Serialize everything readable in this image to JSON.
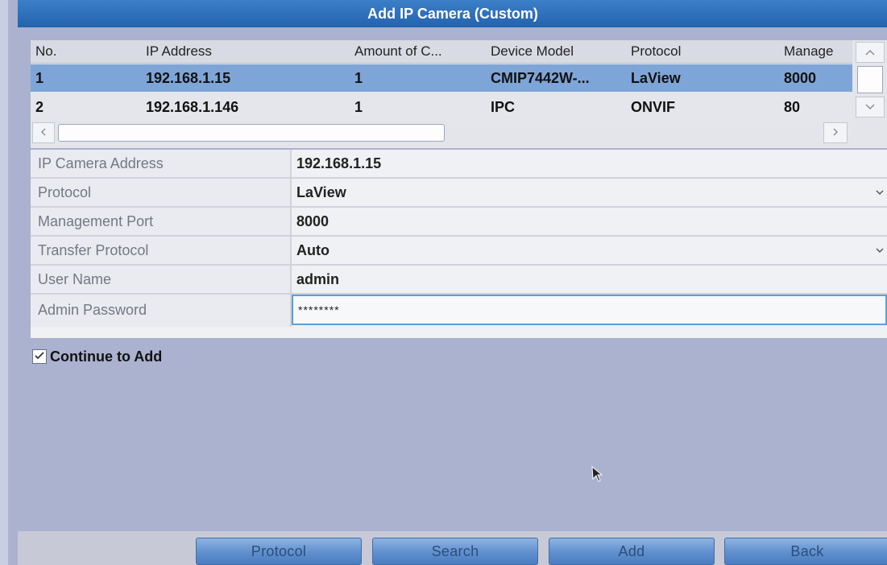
{
  "title": "Add IP Camera (Custom)",
  "table": {
    "columns": [
      "No.",
      "IP Address",
      "Amount of C...",
      "Device Model",
      "Protocol",
      "Manage"
    ],
    "rows": [
      {
        "no": "1",
        "ip": "192.168.1.15",
        "amount": "1",
        "model": "CMIP7442W-...",
        "protocol": "LaView",
        "port": "8000",
        "selected": true
      },
      {
        "no": "2",
        "ip": "192.168.1.146",
        "amount": "1",
        "model": "IPC",
        "protocol": "ONVIF",
        "port": "80",
        "selected": false
      }
    ],
    "scroll_up_icon": "^",
    "scroll_down_icon": "v",
    "scroll_left_icon": "<",
    "scroll_right_icon": ">"
  },
  "form": {
    "ip_camera_address": {
      "label": "IP Camera Address",
      "value": "192.168.1.15"
    },
    "protocol": {
      "label": "Protocol",
      "value": "LaView"
    },
    "management_port": {
      "label": "Management Port",
      "value": "8000"
    },
    "transfer_protocol": {
      "label": "Transfer Protocol",
      "value": "Auto"
    },
    "user_name": {
      "label": "User Name",
      "value": "admin"
    },
    "admin_password": {
      "label": "Admin Password",
      "value": "********"
    }
  },
  "continue_to_add": {
    "label": "Continue to Add",
    "checked": true
  },
  "buttons": {
    "protocol": "Protocol",
    "search": "Search",
    "add": "Add",
    "back": "Back"
  },
  "colors": {
    "accent": "#2263ad",
    "selected_row": "#7ea5d7",
    "background": "#aab2cf"
  }
}
